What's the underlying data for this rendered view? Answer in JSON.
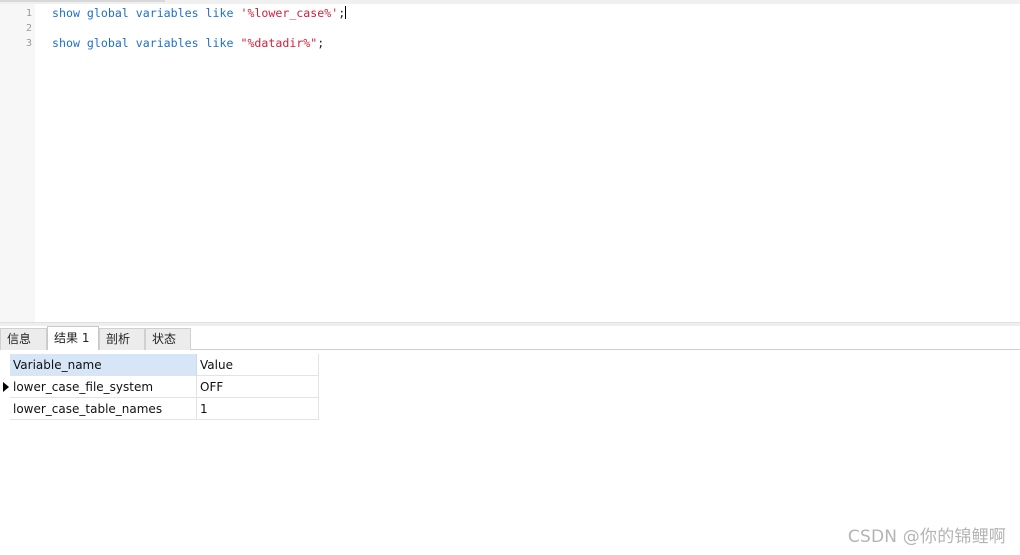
{
  "editor": {
    "lines": [
      {
        "number": "1",
        "keywords": "show global variables like ",
        "string": "'%lower_case%'",
        "end": ";"
      },
      {
        "number": "2"
      },
      {
        "number": "3",
        "keywords": "show global variables like ",
        "string": "\"%datadir%\"",
        "end": ";"
      }
    ]
  },
  "tabs": [
    {
      "label": "信息",
      "active": false
    },
    {
      "label": "结果 1",
      "active": true
    },
    {
      "label": "剖析",
      "active": false
    },
    {
      "label": "状态",
      "active": false
    }
  ],
  "grid": {
    "columns": [
      "Variable_name",
      "Value"
    ],
    "rows": [
      [
        "lower_case_file_system",
        "OFF"
      ],
      [
        "lower_case_table_names",
        "1"
      ]
    ],
    "current_row": 0
  },
  "watermark": "CSDN @你的锦鲤啊",
  "colors": {
    "keyword": "#1f6fc9",
    "string": "#d11f3a",
    "header_selected": "#d7e6f7"
  }
}
